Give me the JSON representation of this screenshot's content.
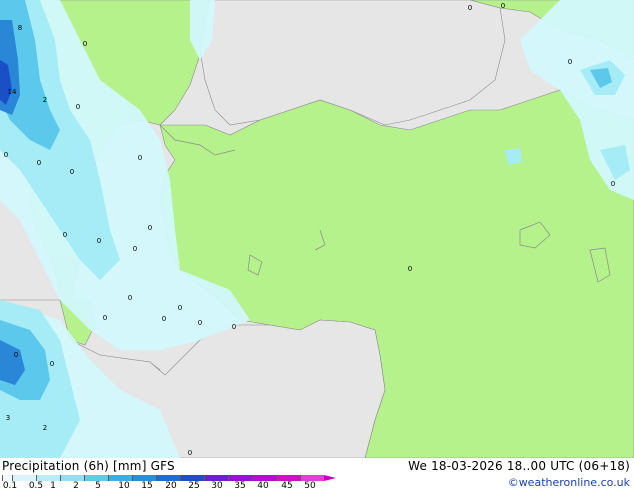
{
  "map": {
    "grid_values": [
      {
        "label": "8"
      },
      {
        "label": "14"
      },
      {
        "label": "2"
      },
      {
        "label": "0"
      },
      {
        "label": "0"
      },
      {
        "label": "0"
      },
      {
        "label": "0"
      },
      {
        "label": "0"
      },
      {
        "label": "0"
      },
      {
        "label": "0"
      },
      {
        "label": "0"
      },
      {
        "label": "0"
      },
      {
        "label": "0"
      },
      {
        "label": "0"
      },
      {
        "label": "0"
      },
      {
        "label": "0"
      },
      {
        "label": "0"
      },
      {
        "label": "0"
      },
      {
        "label": "0"
      },
      {
        "label": "0"
      },
      {
        "label": "0"
      },
      {
        "label": "3"
      },
      {
        "label": "2"
      },
      {
        "label": "0"
      },
      {
        "label": "0"
      },
      {
        "label": "0"
      },
      {
        "label": "0"
      },
      {
        "label": "0"
      },
      {
        "label": "0"
      }
    ],
    "colors": {
      "land_dry": "#b5f28c",
      "sea": "#e6e6e6",
      "precip_light": "#d2f8fc",
      "precip_mid": "#a6ecf6",
      "precip_moderate": "#5cc8ec",
      "precip_heavy": "#2a86d6",
      "precip_very_heavy": "#1a4fc8",
      "coastline": "#8a8a8a"
    }
  },
  "legend": {
    "title": "Precipitation (6h) [mm] GFS",
    "datetime": "We 18-03-2026 18..00 UTC (06+18)",
    "credit": "©weatheronline.co.uk",
    "ticks": [
      "0.1",
      "0.5",
      "1",
      "2",
      "5",
      "10",
      "15",
      "20",
      "25",
      "30",
      "35",
      "40",
      "45",
      "50"
    ],
    "scale_colors": [
      "#f2fbfe",
      "#d9f5fb",
      "#b8edf7",
      "#8ee0f2",
      "#5fcbec",
      "#36b0e6",
      "#238fde",
      "#1a6ed2",
      "#1a4fc8",
      "#6a1fd0",
      "#9a10d6",
      "#c000d8",
      "#d010c8",
      "#e040d8"
    ]
  }
}
